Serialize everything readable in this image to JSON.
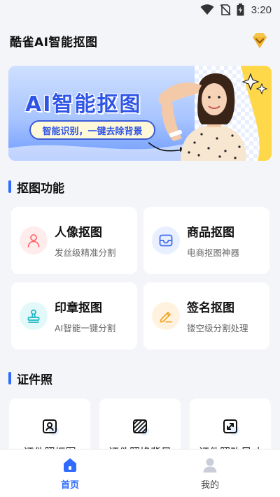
{
  "status_bar": {
    "time": "3:20"
  },
  "header": {
    "title": "酷雀AI智能抠图"
  },
  "banner": {
    "title": "AI智能抠图",
    "subtitle": "智能识别，一键去除背景"
  },
  "sections": {
    "features_title": "抠图功能",
    "id_photo_title": "证件照"
  },
  "features": [
    {
      "title": "人像抠图",
      "subtitle": "发丝级精准分割",
      "icon": "person-icon",
      "color": "#ff6b6b"
    },
    {
      "title": "商品抠图",
      "subtitle": "电商抠图神器",
      "icon": "inbox-icon",
      "color": "#3d6cf0"
    },
    {
      "title": "印章抠图",
      "subtitle": "AI智能一键分割",
      "icon": "stamp-icon",
      "color": "#22b8c4"
    },
    {
      "title": "签名抠图",
      "subtitle": "镂空级分割处理",
      "icon": "pen-icon",
      "color": "#f5a623"
    }
  ],
  "id_photo": [
    {
      "label": "证件照抠图",
      "icon": "id-portrait-icon"
    },
    {
      "label": "证件照换背景",
      "icon": "pattern-icon"
    },
    {
      "label": "证件照改尺寸",
      "icon": "resize-icon"
    }
  ],
  "bottom_nav": [
    {
      "label": "首页",
      "icon": "home-icon",
      "active": true
    },
    {
      "label": "我的",
      "icon": "profile-icon",
      "active": false
    }
  ],
  "colors": {
    "accent": "#2f6bff",
    "background": "#f4f5f9"
  }
}
